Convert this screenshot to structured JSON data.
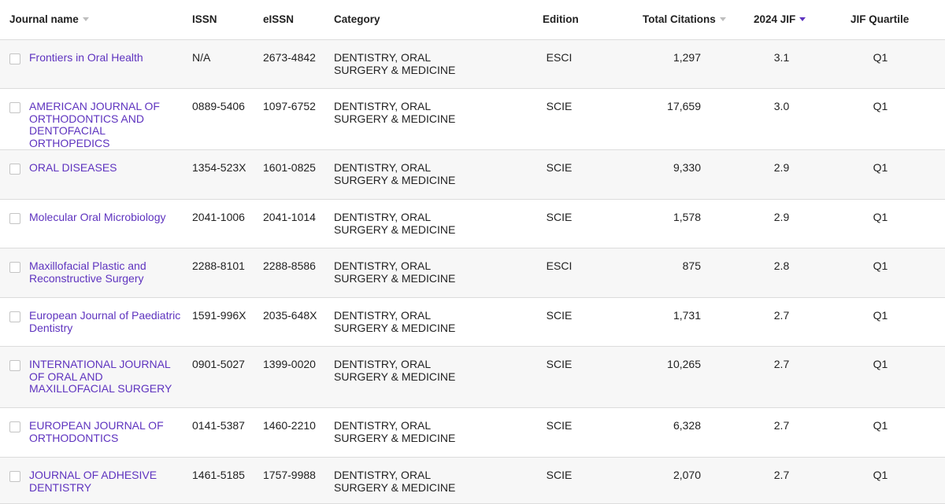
{
  "columns": {
    "journal_name": "Journal name",
    "issn": "ISSN",
    "eissn": "eISSN",
    "category": "Category",
    "edition": "Edition",
    "total_citations": "Total Citations",
    "jif": "2024 JIF",
    "jif_quartile": "JIF Quartile"
  },
  "colors": {
    "link": "#5e33bf",
    "sort_active": "#5e33bf",
    "sort_inactive": "#bdbdbd",
    "row_shade": "#f7f7f7"
  },
  "rows": [
    {
      "name": "Frontiers in Oral Health",
      "issn": "N/A",
      "eissn": "2673-4842",
      "category": "DENTISTRY, ORAL SURGERY & MEDICINE",
      "edition": "ESCI",
      "citations": "1,297",
      "jif": "3.1",
      "quartile": "Q1"
    },
    {
      "name": "AMERICAN JOURNAL OF ORTHODONTICS AND DENTOFACIAL ORTHOPEDICS",
      "issn": "0889-5406",
      "eissn": "1097-6752",
      "category": "DENTISTRY, ORAL SURGERY & MEDICINE",
      "edition": "SCIE",
      "citations": "17,659",
      "jif": "3.0",
      "quartile": "Q1"
    },
    {
      "name": "ORAL DISEASES",
      "issn": "1354-523X",
      "eissn": "1601-0825",
      "category": "DENTISTRY, ORAL SURGERY & MEDICINE",
      "edition": "SCIE",
      "citations": "9,330",
      "jif": "2.9",
      "quartile": "Q1"
    },
    {
      "name": "Molecular Oral Microbiology",
      "issn": "2041-1006",
      "eissn": "2041-1014",
      "category": "DENTISTRY, ORAL SURGERY & MEDICINE",
      "edition": "SCIE",
      "citations": "1,578",
      "jif": "2.9",
      "quartile": "Q1"
    },
    {
      "name": "Maxillofacial Plastic and Reconstructive Surgery",
      "issn": "2288-8101",
      "eissn": "2288-8586",
      "category": "DENTISTRY, ORAL SURGERY & MEDICINE",
      "edition": "ESCI",
      "citations": "875",
      "jif": "2.8",
      "quartile": "Q1"
    },
    {
      "name": "European Journal of Paediatric Dentistry",
      "issn": "1591-996X",
      "eissn": "2035-648X",
      "category": "DENTISTRY, ORAL SURGERY & MEDICINE",
      "edition": "SCIE",
      "citations": "1,731",
      "jif": "2.7",
      "quartile": "Q1"
    },
    {
      "name": "INTERNATIONAL JOURNAL OF ORAL AND MAXILLOFACIAL SURGERY",
      "issn": "0901-5027",
      "eissn": "1399-0020",
      "category": "DENTISTRY, ORAL SURGERY & MEDICINE",
      "edition": "SCIE",
      "citations": "10,265",
      "jif": "2.7",
      "quartile": "Q1"
    },
    {
      "name": "EUROPEAN JOURNAL OF ORTHODONTICS",
      "issn": "0141-5387",
      "eissn": "1460-2210",
      "category": "DENTISTRY, ORAL SURGERY & MEDICINE",
      "edition": "SCIE",
      "citations": "6,328",
      "jif": "2.7",
      "quartile": "Q1"
    },
    {
      "name": "JOURNAL OF ADHESIVE DENTISTRY",
      "issn": "1461-5185",
      "eissn": "1757-9988",
      "category": "DENTISTRY, ORAL SURGERY & MEDICINE",
      "edition": "SCIE",
      "citations": "2,070",
      "jif": "2.7",
      "quartile": "Q1"
    }
  ]
}
